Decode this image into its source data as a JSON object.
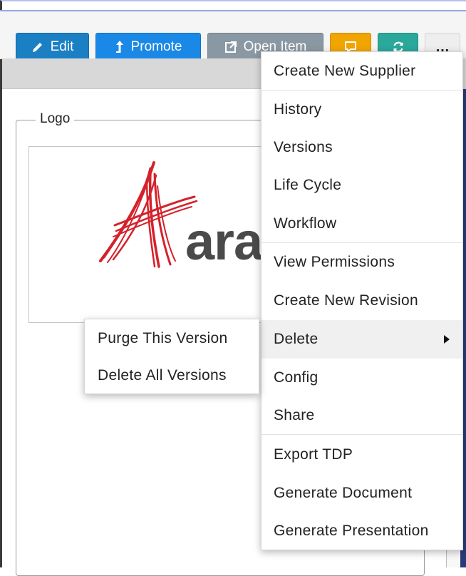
{
  "toolbar": {
    "edit_label": "Edit",
    "promote_label": "Promote",
    "open_item_label": "Open Item",
    "more_label": "…",
    "colors": {
      "edit": "#1b7fc4",
      "promote": "#1a88e6",
      "open_item": "#8a98a3",
      "comment": "#f0a500",
      "refresh": "#2aa89b"
    },
    "icons": [
      "pencil-icon",
      "promote-arrow-icon",
      "external-link-icon",
      "comment-icon",
      "refresh-icon",
      "ellipsis-icon"
    ]
  },
  "form": {
    "logo_legend": "Logo",
    "logo_partial_text": "ara"
  },
  "menu": {
    "items": [
      {
        "label": "Create New Supplier"
      },
      {
        "label": "History"
      },
      {
        "label": "Versions"
      },
      {
        "label": "Life Cycle"
      },
      {
        "label": "Workflow"
      },
      {
        "label": "View Permissions"
      },
      {
        "label": "Create New Revision"
      },
      {
        "label": "Delete"
      },
      {
        "label": "Config"
      },
      {
        "label": "Share"
      },
      {
        "label": "Export TDP"
      },
      {
        "label": "Generate Document"
      },
      {
        "label": "Generate Presentation"
      }
    ]
  },
  "submenu": {
    "items": [
      {
        "label": "Purge This Version"
      },
      {
        "label": "Delete All Versions"
      }
    ]
  }
}
